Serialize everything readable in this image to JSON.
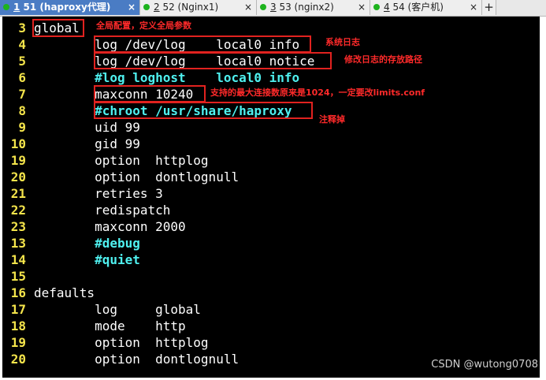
{
  "tabs": [
    {
      "num": "1",
      "label": "51  (haproxy代理)",
      "active": true,
      "close": "×"
    },
    {
      "num": "2",
      "label": "52  (Nginx1)",
      "active": false,
      "close": "×"
    },
    {
      "num": "3",
      "label": "53  (nginx2)",
      "active": false,
      "close": "×"
    },
    {
      "num": "4",
      "label": "54  (客户机)",
      "active": false,
      "close": "×"
    }
  ],
  "tab_add": "+",
  "colors": {
    "terminal_bg": "#000000",
    "line_number": "#f4e44b",
    "comment": "#4ff0ef",
    "annotation": "#e1221f",
    "active_tab": "#4a7cc4",
    "status_dot": "#1db31d"
  },
  "lines": [
    {
      "n": "3",
      "text": "global"
    },
    {
      "n": "4",
      "text": "        log /dev/log    local0 info"
    },
    {
      "n": "5",
      "text": "        log /dev/log    local0 notice"
    },
    {
      "n": "6",
      "text": "        #log loghost    local0 info"
    },
    {
      "n": "7",
      "text": "        maxconn 10240"
    },
    {
      "n": "8",
      "text": "        #chroot /usr/share/haproxy"
    },
    {
      "n": "9",
      "text": "        uid 99"
    },
    {
      "n": "10",
      "text": "        gid 99"
    },
    {
      "n": "19",
      "text": "        option  httplog"
    },
    {
      "n": "20",
      "text": "        option  dontlognull"
    },
    {
      "n": "21",
      "text": "        retries 3"
    },
    {
      "n": "22",
      "text": "        redispatch"
    },
    {
      "n": "23",
      "text": "        maxconn 2000"
    },
    {
      "n": "13",
      "text": "        #debug"
    },
    {
      "n": "14",
      "text": "        #quiet"
    },
    {
      "n": "15",
      "text": ""
    },
    {
      "n": "16",
      "text": "defaults"
    },
    {
      "n": "17",
      "text": "        log     global"
    },
    {
      "n": "18",
      "text": "        mode    http"
    },
    {
      "n": "19",
      "text": "        option  httplog"
    },
    {
      "n": "20",
      "text": "        option  dontlognull"
    }
  ],
  "annotations": {
    "global": "全局配置，定义全局参数",
    "system_log": "系统日志",
    "log_path": "修改日志的存放路径",
    "maxconn": "支持的最大连接数原来是1024，一定要改limits.conf",
    "chroot": "注释掉"
  },
  "watermark": "CSDN @wutong0708"
}
